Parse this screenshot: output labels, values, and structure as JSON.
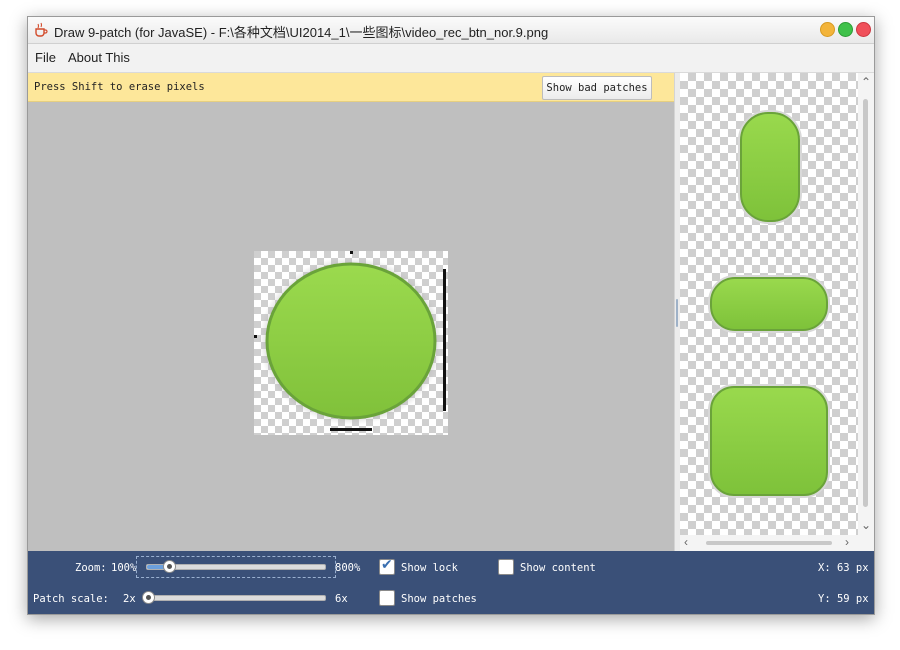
{
  "window": {
    "title": "Draw 9-patch (for JavaSE) - F:\\各种文档\\UI2014_1\\一些图标\\video_rec_btn_nor.9.png",
    "app_icon": "coffee-cup-icon"
  },
  "menu": {
    "items": [
      {
        "label": "File"
      },
      {
        "label": "About This"
      }
    ]
  },
  "editor": {
    "hint": "Press Shift to erase pixels",
    "bad_patches_button": "Show bad patches",
    "image_fill_color": "#8fd444",
    "image_border_color": "#6aa33a"
  },
  "status": {
    "zoom": {
      "label": "Zoom:",
      "min": "100%",
      "max": "800%",
      "value_fraction": 0.12
    },
    "patch_scale": {
      "label": "Patch scale:",
      "min": "2x",
      "max": "6x",
      "value_fraction": 0.0
    },
    "show_lock": {
      "label": "Show lock",
      "checked": true
    },
    "show_content": {
      "label": "Show content",
      "checked": false
    },
    "show_patches": {
      "label": "Show patches",
      "checked": false
    },
    "x_readout": "X: 63 px",
    "y_readout": "Y: 59 px"
  },
  "colors": {
    "status_bg": "#3a5078",
    "hint_bg": "#fde79a",
    "canvas_bg": "#bfbfbf",
    "green": "#8fd444"
  }
}
